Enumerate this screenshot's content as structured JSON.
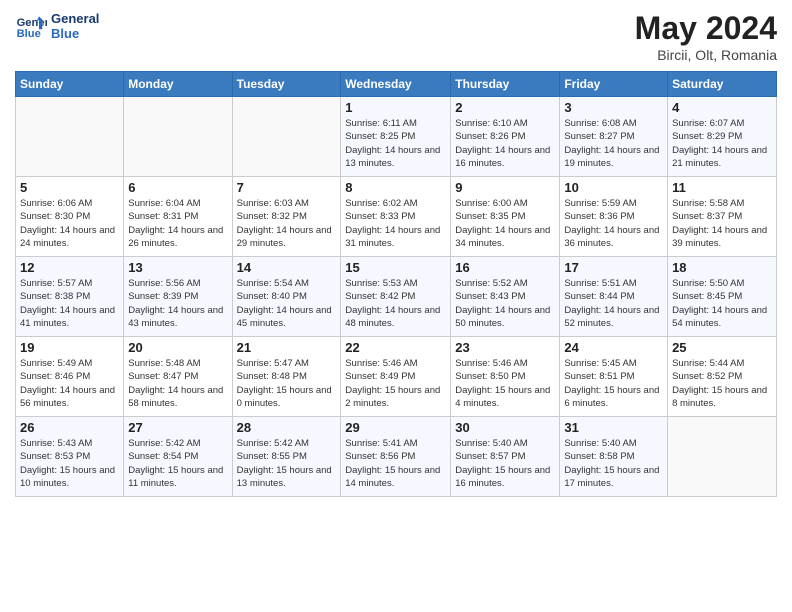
{
  "header": {
    "logo_line1": "General",
    "logo_line2": "Blue",
    "month": "May 2024",
    "location": "Bircii, Olt, Romania"
  },
  "weekdays": [
    "Sunday",
    "Monday",
    "Tuesday",
    "Wednesday",
    "Thursday",
    "Friday",
    "Saturday"
  ],
  "weeks": [
    [
      {
        "day": "",
        "sunrise": "",
        "sunset": "",
        "daylight": ""
      },
      {
        "day": "",
        "sunrise": "",
        "sunset": "",
        "daylight": ""
      },
      {
        "day": "",
        "sunrise": "",
        "sunset": "",
        "daylight": ""
      },
      {
        "day": "1",
        "sunrise": "Sunrise: 6:11 AM",
        "sunset": "Sunset: 8:25 PM",
        "daylight": "Daylight: 14 hours and 13 minutes."
      },
      {
        "day": "2",
        "sunrise": "Sunrise: 6:10 AM",
        "sunset": "Sunset: 8:26 PM",
        "daylight": "Daylight: 14 hours and 16 minutes."
      },
      {
        "day": "3",
        "sunrise": "Sunrise: 6:08 AM",
        "sunset": "Sunset: 8:27 PM",
        "daylight": "Daylight: 14 hours and 19 minutes."
      },
      {
        "day": "4",
        "sunrise": "Sunrise: 6:07 AM",
        "sunset": "Sunset: 8:29 PM",
        "daylight": "Daylight: 14 hours and 21 minutes."
      }
    ],
    [
      {
        "day": "5",
        "sunrise": "Sunrise: 6:06 AM",
        "sunset": "Sunset: 8:30 PM",
        "daylight": "Daylight: 14 hours and 24 minutes."
      },
      {
        "day": "6",
        "sunrise": "Sunrise: 6:04 AM",
        "sunset": "Sunset: 8:31 PM",
        "daylight": "Daylight: 14 hours and 26 minutes."
      },
      {
        "day": "7",
        "sunrise": "Sunrise: 6:03 AM",
        "sunset": "Sunset: 8:32 PM",
        "daylight": "Daylight: 14 hours and 29 minutes."
      },
      {
        "day": "8",
        "sunrise": "Sunrise: 6:02 AM",
        "sunset": "Sunset: 8:33 PM",
        "daylight": "Daylight: 14 hours and 31 minutes."
      },
      {
        "day": "9",
        "sunrise": "Sunrise: 6:00 AM",
        "sunset": "Sunset: 8:35 PM",
        "daylight": "Daylight: 14 hours and 34 minutes."
      },
      {
        "day": "10",
        "sunrise": "Sunrise: 5:59 AM",
        "sunset": "Sunset: 8:36 PM",
        "daylight": "Daylight: 14 hours and 36 minutes."
      },
      {
        "day": "11",
        "sunrise": "Sunrise: 5:58 AM",
        "sunset": "Sunset: 8:37 PM",
        "daylight": "Daylight: 14 hours and 39 minutes."
      }
    ],
    [
      {
        "day": "12",
        "sunrise": "Sunrise: 5:57 AM",
        "sunset": "Sunset: 8:38 PM",
        "daylight": "Daylight: 14 hours and 41 minutes."
      },
      {
        "day": "13",
        "sunrise": "Sunrise: 5:56 AM",
        "sunset": "Sunset: 8:39 PM",
        "daylight": "Daylight: 14 hours and 43 minutes."
      },
      {
        "day": "14",
        "sunrise": "Sunrise: 5:54 AM",
        "sunset": "Sunset: 8:40 PM",
        "daylight": "Daylight: 14 hours and 45 minutes."
      },
      {
        "day": "15",
        "sunrise": "Sunrise: 5:53 AM",
        "sunset": "Sunset: 8:42 PM",
        "daylight": "Daylight: 14 hours and 48 minutes."
      },
      {
        "day": "16",
        "sunrise": "Sunrise: 5:52 AM",
        "sunset": "Sunset: 8:43 PM",
        "daylight": "Daylight: 14 hours and 50 minutes."
      },
      {
        "day": "17",
        "sunrise": "Sunrise: 5:51 AM",
        "sunset": "Sunset: 8:44 PM",
        "daylight": "Daylight: 14 hours and 52 minutes."
      },
      {
        "day": "18",
        "sunrise": "Sunrise: 5:50 AM",
        "sunset": "Sunset: 8:45 PM",
        "daylight": "Daylight: 14 hours and 54 minutes."
      }
    ],
    [
      {
        "day": "19",
        "sunrise": "Sunrise: 5:49 AM",
        "sunset": "Sunset: 8:46 PM",
        "daylight": "Daylight: 14 hours and 56 minutes."
      },
      {
        "day": "20",
        "sunrise": "Sunrise: 5:48 AM",
        "sunset": "Sunset: 8:47 PM",
        "daylight": "Daylight: 14 hours and 58 minutes."
      },
      {
        "day": "21",
        "sunrise": "Sunrise: 5:47 AM",
        "sunset": "Sunset: 8:48 PM",
        "daylight": "Daylight: 15 hours and 0 minutes."
      },
      {
        "day": "22",
        "sunrise": "Sunrise: 5:46 AM",
        "sunset": "Sunset: 8:49 PM",
        "daylight": "Daylight: 15 hours and 2 minutes."
      },
      {
        "day": "23",
        "sunrise": "Sunrise: 5:46 AM",
        "sunset": "Sunset: 8:50 PM",
        "daylight": "Daylight: 15 hours and 4 minutes."
      },
      {
        "day": "24",
        "sunrise": "Sunrise: 5:45 AM",
        "sunset": "Sunset: 8:51 PM",
        "daylight": "Daylight: 15 hours and 6 minutes."
      },
      {
        "day": "25",
        "sunrise": "Sunrise: 5:44 AM",
        "sunset": "Sunset: 8:52 PM",
        "daylight": "Daylight: 15 hours and 8 minutes."
      }
    ],
    [
      {
        "day": "26",
        "sunrise": "Sunrise: 5:43 AM",
        "sunset": "Sunset: 8:53 PM",
        "daylight": "Daylight: 15 hours and 10 minutes."
      },
      {
        "day": "27",
        "sunrise": "Sunrise: 5:42 AM",
        "sunset": "Sunset: 8:54 PM",
        "daylight": "Daylight: 15 hours and 11 minutes."
      },
      {
        "day": "28",
        "sunrise": "Sunrise: 5:42 AM",
        "sunset": "Sunset: 8:55 PM",
        "daylight": "Daylight: 15 hours and 13 minutes."
      },
      {
        "day": "29",
        "sunrise": "Sunrise: 5:41 AM",
        "sunset": "Sunset: 8:56 PM",
        "daylight": "Daylight: 15 hours and 14 minutes."
      },
      {
        "day": "30",
        "sunrise": "Sunrise: 5:40 AM",
        "sunset": "Sunset: 8:57 PM",
        "daylight": "Daylight: 15 hours and 16 minutes."
      },
      {
        "day": "31",
        "sunrise": "Sunrise: 5:40 AM",
        "sunset": "Sunset: 8:58 PM",
        "daylight": "Daylight: 15 hours and 17 minutes."
      },
      {
        "day": "",
        "sunrise": "",
        "sunset": "",
        "daylight": ""
      }
    ]
  ]
}
